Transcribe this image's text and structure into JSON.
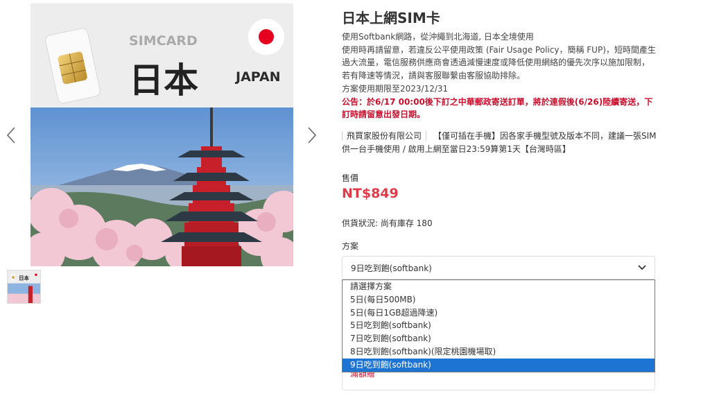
{
  "gallery": {
    "image_text": {
      "simcard": "SIMCARD",
      "kanji": "日本",
      "japan": "JAPAN"
    },
    "colors": {
      "flag_red": "#e6001f",
      "sky": "#6d9ed6",
      "pagoda": "#c8202a",
      "blossom": "#f1c8d3"
    },
    "icons": {
      "prev": "chevron-left-icon",
      "next": "chevron-right-icon"
    }
  },
  "product": {
    "title": "日本上網SIM卡",
    "description": [
      "使用Softbank網路，從沖繩到北海道, 日本全境使用",
      "使用時再請留意，若違反公平使用政策 (Fair Usage Policy，簡稱 FUP)，短時間產生過大流量，電信服務供應商會透過減慢速度或降低使用網絡的優先次序以施加限制，若有降速等情況，請與客服聯繫由客服協助排除。",
      "方案使用期限至2023/12/31"
    ],
    "notice": "公告：於6/17 00:00後下訂之中華郵政寄送訂單，將於連假後(6/26)陸續寄送，下訂時請留意出發日期。",
    "vendor": "飛買家股份有限公司",
    "vendor_note": "【僅可插在手機】因各家手機型號及版本不同，建議一張SIM供一台手機使用 / 啟用上網至當日23:59算第1天【台灣時區】",
    "price_label": "售價",
    "price": "NT$849",
    "stock": "供貨狀況: 尚有庫存 180",
    "plan_label": "方案",
    "selected_plan": "9日吃到飽(softbank)",
    "under_text": "滿額贈",
    "accent_color": "#e03a4a",
    "notice_color": "#c8102e"
  },
  "dropdown": {
    "options": [
      "請選擇方案",
      "5日(每日500MB)",
      "5日(每日1GB超過降速)",
      "5日吃到飽(softbank)",
      "7日吃到飽(softbank)",
      "8日吃到飽(softbank)(限定桃園機場取)",
      "9日吃到飽(softbank)"
    ],
    "selected_index": 6,
    "highlight_color": "#1e74d2"
  }
}
